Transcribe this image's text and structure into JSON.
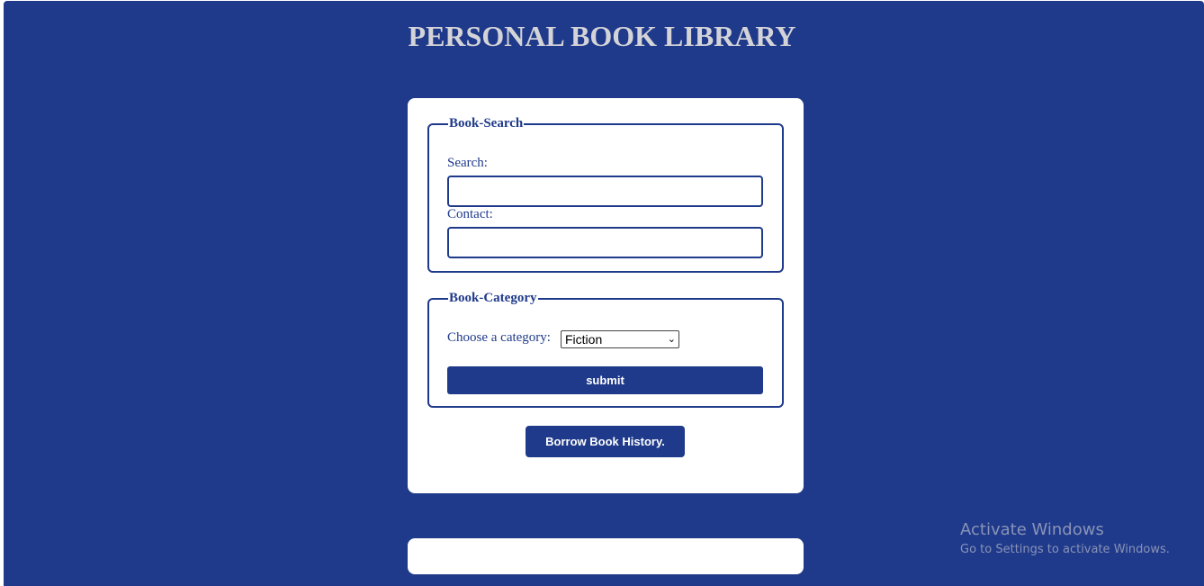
{
  "header": {
    "title": "PERSONAL BOOK LIBRARY"
  },
  "search_section": {
    "legend": "Book-Search",
    "search_label": "Search:",
    "search_value": "",
    "contact_label": "Contact:",
    "contact_value": ""
  },
  "category_section": {
    "legend": "Book-Category",
    "choose_label": "Choose a category:",
    "selected_category": "Fiction",
    "submit_label": "submit"
  },
  "history_button_label": "Borrow Book History.",
  "watermark": {
    "title": "Activate Windows",
    "subtitle": "Go to Settings to activate Windows."
  },
  "colors": {
    "background": "#1f3a8a",
    "accent": "#1f3a8a",
    "title_text": "#d4d4d8",
    "card": "#ffffff"
  },
  "icons": {
    "select_arrow": "chevron-down-icon"
  }
}
